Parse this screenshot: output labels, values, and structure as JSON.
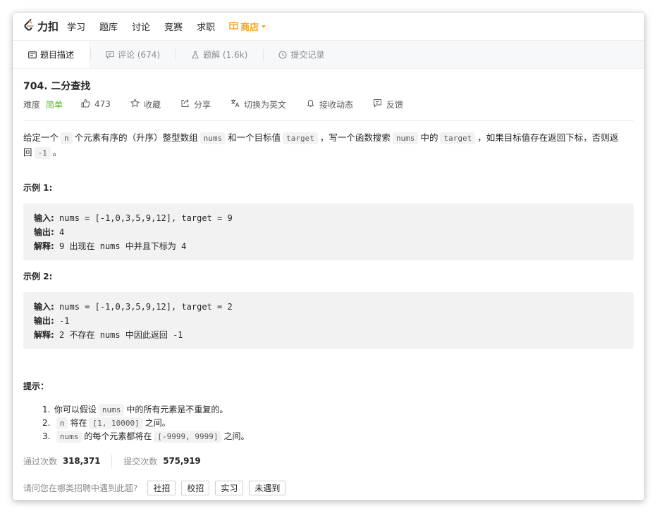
{
  "nav": {
    "brand": "力扣",
    "items": [
      "学习",
      "题库",
      "讨论",
      "竞赛",
      "求职"
    ],
    "store": "商店",
    "store_color": "#ffa116"
  },
  "tabs": [
    {
      "label": "题目描述",
      "icon": "description-icon",
      "active": true
    },
    {
      "label": "评论 (674)",
      "icon": "comment-icon",
      "active": false
    },
    {
      "label": "题解 (1.6k)",
      "icon": "flask-icon",
      "active": false
    },
    {
      "label": "提交记录",
      "icon": "clock-icon",
      "active": false
    }
  ],
  "problem": {
    "title": "704. 二分查找",
    "difficulty_label": "难度",
    "difficulty": "简单",
    "difficulty_color": "#5ab726",
    "likes": "473",
    "favorite": "收藏",
    "share": "分享",
    "switch_lang": "切换为英文",
    "notify": "接收动态",
    "feedback": "反馈"
  },
  "description": {
    "t1": "给定一个",
    "c1": "n",
    "t2": "个元素有序的（升序）整型数组",
    "c2": "nums",
    "t3": "和一个目标值",
    "c3": "target",
    "t4": "，写一个函数搜索",
    "c4": "nums",
    "t5": "中的",
    "c5": "target",
    "t6": "，如果目标值存在返回下标，否则返回",
    "c6": "-1",
    "t7": "。"
  },
  "examples": [
    {
      "title": "示例 1:",
      "input_label": "输入:",
      "input": "nums = [-1,0,3,5,9,12], target = 9",
      "output_label": "输出:",
      "output": "4",
      "explain_label": "解释:",
      "explain": "9 出现在 nums 中并且下标为 4"
    },
    {
      "title": "示例 2:",
      "input_label": "输入:",
      "input": "nums = [-1,0,3,5,9,12], target = 2",
      "output_label": "输出:",
      "output": "-1",
      "explain_label": "解释:",
      "explain": "2 不存在 nums 中因此返回 -1"
    }
  ],
  "hints": {
    "title": "提示：",
    "items": [
      {
        "num": "1.",
        "pre": "你可以假设",
        "code": "nums",
        "post": "中的所有元素是不重复的。"
      },
      {
        "num": "2.",
        "pre": "",
        "code": "n",
        "mid": "将在",
        "code2": "[1, 10000]",
        "post": "之间。"
      },
      {
        "num": "3.",
        "pre": "",
        "code": "nums",
        "mid": "的每个元素都将在",
        "code2": "[-9999, 9999]",
        "post": "之间。"
      }
    ]
  },
  "stats": {
    "accepted_label": "通过次数",
    "accepted": "318,371",
    "submitted_label": "提交次数",
    "submitted": "575,919"
  },
  "survey": {
    "question": "请问您在哪类招聘中遇到此题?",
    "options": [
      "社招",
      "校招",
      "实习",
      "未遇到"
    ]
  }
}
